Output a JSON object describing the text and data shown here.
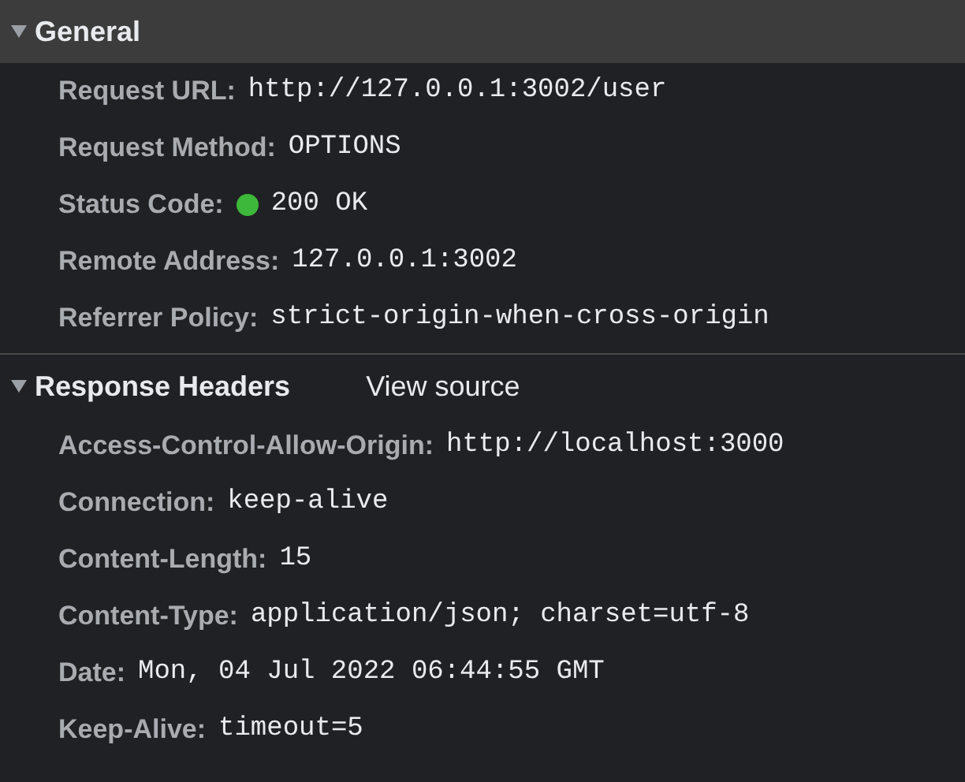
{
  "sections": [
    {
      "title": "General",
      "expanded": true,
      "selected": true,
      "rows": [
        {
          "name": "Request URL:",
          "value": "http://127.0.0.1:3002/user"
        },
        {
          "name": "Request Method:",
          "value": "OPTIONS"
        },
        {
          "name": "Status Code:",
          "value": "200 OK",
          "color": "#3db83a"
        },
        {
          "name": "Remote Address:",
          "value": "127.0.0.1:3002"
        },
        {
          "name": "Referrer Policy:",
          "value": "strict-origin-when-cross-origin"
        }
      ]
    },
    {
      "title": "Response Headers",
      "expanded": true,
      "selected": false,
      "link": "View source",
      "rows": [
        {
          "name": "Access-Control-Allow-Origin:",
          "value": "http://localhost:3000"
        },
        {
          "name": "Connection:",
          "value": "keep-alive"
        },
        {
          "name": "Content-Length:",
          "value": "15"
        },
        {
          "name": "Content-Type:",
          "value": "application/json; charset=utf-8"
        },
        {
          "name": "Date:",
          "value": "Mon, 04 Jul 2022 06:44:55 GMT"
        },
        {
          "name": "Keep-Alive:",
          "value": "timeout=5"
        }
      ]
    }
  ]
}
